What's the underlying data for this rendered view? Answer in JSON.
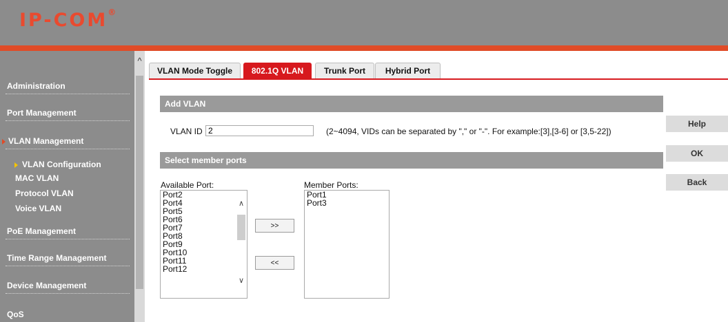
{
  "brand": {
    "logo_text": "IP-COM",
    "trademark": "®",
    "accent": "#e04b27"
  },
  "sidebar": {
    "items": [
      {
        "label": "Administration"
      },
      {
        "label": "Port Management"
      },
      {
        "label": "VLAN Management"
      },
      {
        "label": "PoE Management"
      },
      {
        "label": "Time Range Management"
      },
      {
        "label": "Device Management"
      },
      {
        "label": "QoS"
      }
    ],
    "subitems": [
      {
        "label": "VLAN Configuration"
      },
      {
        "label": "MAC VLAN"
      },
      {
        "label": "Protocol VLAN"
      },
      {
        "label": "Voice VLAN"
      }
    ]
  },
  "tabs": [
    {
      "label": "VLAN Mode Toggle"
    },
    {
      "label": "802.1Q VLAN",
      "active": true
    },
    {
      "label": "Trunk Port"
    },
    {
      "label": "Hybrid Port"
    }
  ],
  "add_vlan": {
    "title": "Add VLAN",
    "vlan_id_label": "VLAN ID",
    "vlan_id_value": "2",
    "hint": "(2~4094, VIDs can be separated by \",\" or \"-\". For example:[3],[3-6] or [3,5-22])"
  },
  "member": {
    "title": "Select member ports",
    "available_label": "Available Port:",
    "member_label": "Member Ports:",
    "available_ports": [
      "Port2",
      "Port4",
      "Port5",
      "Port6",
      "Port7",
      "Port8",
      "Port9",
      "Port10",
      "Port11",
      "Port12"
    ],
    "member_ports": [
      "Port1",
      "Port3"
    ],
    "add_button": ">>",
    "remove_button": "<<"
  },
  "actions": {
    "help": "Help",
    "ok": "OK",
    "back": "Back"
  }
}
